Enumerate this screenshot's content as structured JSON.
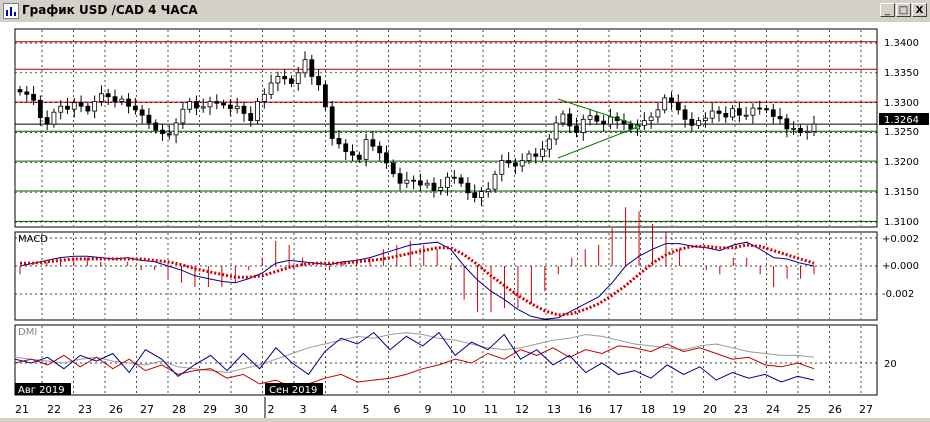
{
  "window": {
    "title": "График USD /CAD  4 ЧАСА",
    "minimize_glyph": "_",
    "restore_glyph": "□",
    "close_glyph": "X"
  },
  "colors": {
    "up_candle": "#ffffff",
    "down_candle": "#000000",
    "resistance": "#b00000",
    "support": "#006000",
    "macd_line": "#00008b",
    "macd_signal": "#d00000",
    "dmi_plus": "#00008b",
    "dmi_minus": "#c00000",
    "adx": "#999999",
    "triangle": "#008000"
  },
  "price_panel": {
    "last_price": "1.3264",
    "axis_labels": [
      "1.3400",
      "1.3350",
      "1.3300",
      "1.3250",
      "1.3200",
      "1.3150",
      "1.3100"
    ],
    "levels": [
      {
        "kind": "resistance",
        "value": 1.3402
      },
      {
        "kind": "resistance",
        "value": 1.3356
      },
      {
        "kind": "resistance",
        "value": 1.3301
      },
      {
        "kind": "last",
        "value": 1.3264
      },
      {
        "kind": "support",
        "value": 1.3252
      },
      {
        "kind": "support",
        "value": 1.3202
      },
      {
        "kind": "support",
        "value": 1.3152
      },
      {
        "kind": "support",
        "value": 1.3101
      }
    ],
    "closes": [
      1.3318,
      1.3314,
      1.3304,
      1.3275,
      1.3264,
      1.3284,
      1.3294,
      1.3289,
      1.33,
      1.3294,
      1.3286,
      1.3302,
      1.3315,
      1.331,
      1.3302,
      1.3306,
      1.3294,
      1.3288,
      1.3279,
      1.3266,
      1.3254,
      1.3248,
      1.3246,
      1.3266,
      1.3289,
      1.3302,
      1.3291,
      1.3293,
      1.3302,
      1.3299,
      1.3296,
      1.329,
      1.3294,
      1.3282,
      1.327,
      1.3302,
      1.3314,
      1.3333,
      1.3344,
      1.334,
      1.3332,
      1.335,
      1.3372,
      1.3344,
      1.333,
      1.3293,
      1.324,
      1.3231,
      1.3218,
      1.3212,
      1.3205,
      1.3238,
      1.3227,
      1.3216,
      1.3199,
      1.3181,
      1.3165,
      1.317,
      1.3169,
      1.3162,
      1.3165,
      1.3153,
      1.3158,
      1.3175,
      1.3174,
      1.3165,
      1.3149,
      1.3141,
      1.3151,
      1.3155,
      1.318,
      1.3203,
      1.3199,
      1.3194,
      1.3203,
      1.3214,
      1.321,
      1.3222,
      1.3239,
      1.3266,
      1.3281,
      1.3261,
      1.325,
      1.3272,
      1.3278,
      1.3269,
      1.3264,
      1.3276,
      1.327,
      1.3264,
      1.3256,
      1.3262,
      1.327,
      1.3276,
      1.3288,
      1.3308,
      1.33,
      1.3288,
      1.3272,
      1.3262,
      1.327,
      1.3274,
      1.3286,
      1.3282,
      1.3276,
      1.329,
      1.3279,
      1.3279,
      1.3291,
      1.329,
      1.3288,
      1.3277,
      1.3273,
      1.3256,
      1.3257,
      1.325,
      1.3252,
      1.3264
    ]
  },
  "macd_panel": {
    "label": "MACD",
    "axis_labels": [
      "+0.002",
      "+0.000",
      "-0.002"
    ],
    "macd": [
      0.0,
      0.0002,
      0.0004,
      0.0006,
      0.0007,
      0.0007,
      0.0006,
      0.0005,
      0.0006,
      0.0004,
      0.0003,
      0.0,
      -0.0003,
      -0.0007,
      -0.0009,
      -0.0011,
      -0.0012,
      -0.0009,
      -0.0005,
      0.0002,
      0.0004,
      0.0003,
      0.0002,
      0.0001,
      0.0003,
      0.0004,
      0.0006,
      0.0009,
      0.0012,
      0.0015,
      0.0016,
      0.0017,
      0.0012,
      0.0,
      -0.001,
      -0.0018,
      -0.0024,
      -0.0031,
      -0.0036,
      -0.0038,
      -0.0037,
      -0.0032,
      -0.0027,
      -0.0022,
      -0.0012,
      0.0,
      0.0007,
      0.0012,
      0.0016,
      0.0016,
      0.0014,
      0.0013,
      0.0011,
      0.0015,
      0.0017,
      0.0012,
      0.0006,
      0.0005,
      0.0002,
      0.0
    ],
    "signal": [
      0.0002,
      0.0002,
      0.0003,
      0.0004,
      0.0005,
      0.0005,
      0.0005,
      0.0005,
      0.0005,
      0.0005,
      0.0004,
      0.0003,
      0.0001,
      -0.0002,
      -0.0004,
      -0.0006,
      -0.0008,
      -0.0008,
      -0.0007,
      -0.0004,
      -0.0001,
      0.0001,
      0.0002,
      0.0002,
      0.0002,
      0.0003,
      0.0004,
      0.0005,
      0.0007,
      0.0009,
      0.0011,
      0.0013,
      0.0013,
      0.0008,
      0.0001,
      -0.0007,
      -0.0014,
      -0.0021,
      -0.0027,
      -0.0032,
      -0.0035,
      -0.0034,
      -0.0031,
      -0.0027,
      -0.0021,
      -0.0014,
      -0.0006,
      0.0002,
      0.0008,
      0.0012,
      0.0014,
      0.0014,
      0.0013,
      0.0013,
      0.0015,
      0.0014,
      0.0011,
      0.0008,
      0.0005,
      0.0002
    ]
  },
  "dmi_panel": {
    "label": "DMI",
    "axis_labels": [
      "20"
    ],
    "plus_di": [
      22,
      20,
      23,
      17,
      24,
      21,
      25,
      15,
      27,
      22,
      13,
      19,
      24,
      16,
      25,
      17,
      28,
      20,
      14,
      26,
      33,
      30,
      36,
      27,
      34,
      29,
      36,
      24,
      31,
      27,
      35,
      22,
      27,
      19,
      24,
      15,
      20,
      14,
      16,
      12,
      19,
      14,
      18,
      11,
      15,
      12,
      14,
      10,
      13,
      11
    ],
    "minus_di": [
      20,
      22,
      19,
      24,
      18,
      23,
      17,
      22,
      16,
      19,
      14,
      16,
      17,
      12,
      14,
      9,
      11,
      7,
      9,
      12,
      14,
      10,
      11,
      12,
      14,
      17,
      19,
      22,
      20,
      25,
      22,
      27,
      24,
      28,
      23,
      27,
      25,
      29,
      28,
      26,
      30,
      26,
      28,
      25,
      22,
      23,
      19,
      18,
      20,
      17
    ],
    "adx": [
      23,
      22,
      21,
      20,
      22,
      23,
      21,
      20,
      19,
      21,
      18,
      17,
      16,
      15,
      17,
      19,
      22,
      25,
      28,
      30,
      32,
      34,
      33,
      35,
      36,
      35,
      33,
      32,
      30,
      28,
      27,
      28,
      30,
      32,
      33,
      35,
      34,
      32,
      30,
      29,
      28,
      27,
      29,
      30,
      28,
      26,
      25,
      24,
      24,
      23
    ]
  },
  "x_axis": {
    "ticks": [
      "21",
      "22",
      "23",
      "26",
      "27",
      "28",
      "29",
      "30",
      "2",
      "3",
      "4",
      "5",
      "6",
      "9",
      "10",
      "11",
      "12",
      "13",
      "16",
      "17",
      "18",
      "19",
      "20",
      "23",
      "24",
      "25",
      "26",
      "27"
    ],
    "month_markers": [
      "Авг 2019",
      "Сен 2019"
    ]
  }
}
